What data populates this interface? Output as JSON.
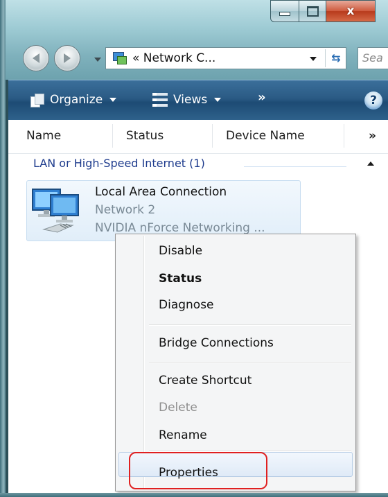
{
  "address_bar": {
    "path_text": "« Network C...",
    "search_placeholder": "Sea"
  },
  "caption_buttons": {
    "minimize": "minimize-icon",
    "maximize": "maximize-icon",
    "close": "x"
  },
  "command_bar": {
    "organize_label": "Organize",
    "views_label": "Views",
    "more_label": "»",
    "help_label": "?"
  },
  "columns": {
    "name": "Name",
    "status": "Status",
    "device_name": "Device Name",
    "more": "»"
  },
  "group": {
    "title": "LAN or High-Speed Internet (1)"
  },
  "connection": {
    "title": "Local Area Connection",
    "network": "Network  2",
    "device": "NVIDIA nForce Networking ..."
  },
  "context_menu": {
    "items": [
      "Disable",
      "Status",
      "Diagnose",
      "Bridge Connections",
      "Create Shortcut",
      "Delete",
      "Rename",
      "Properties"
    ]
  },
  "colors": {
    "command_bar": "#2a5a84",
    "highlight_outline": "#e02020",
    "group_text": "#1c3a8c"
  }
}
